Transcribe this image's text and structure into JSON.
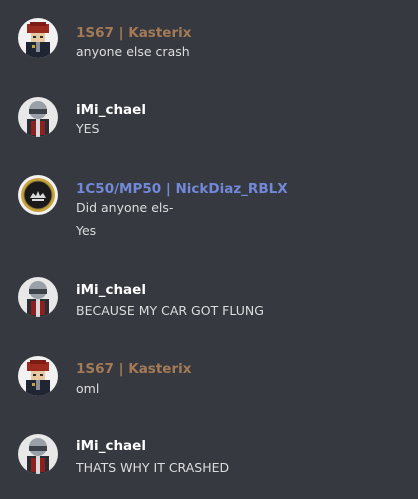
{
  "colors": {
    "background": "#36393f",
    "message_text": "#dcddde",
    "role_brown": "#a57b57",
    "role_white": "#ffffff",
    "role_blue": "#7289da"
  },
  "messages": [
    {
      "username": "1S67 | Kasterix",
      "username_color": "#a57b57",
      "avatar": "roblox-avatar-red-hat-icon",
      "lines": [
        "anyone else crash"
      ]
    },
    {
      "username": "iMi_chael",
      "username_color": "#ffffff",
      "avatar": "roblox-avatar-helmet-icon",
      "lines": [
        "YES"
      ]
    },
    {
      "username": "1C50/MP50 | NickDiaz_RBLX",
      "username_color": "#7289da",
      "avatar": "police-badge-emblem-icon",
      "lines": [
        "Did anyone els-",
        "Yes"
      ]
    },
    {
      "username": "iMi_chael",
      "username_color": "#ffffff",
      "avatar": "roblox-avatar-helmet-icon",
      "lines": [
        "BECAUSE MY CAR GOT FLUNG"
      ]
    },
    {
      "username": "1S67 | Kasterix",
      "username_color": "#a57b57",
      "avatar": "roblox-avatar-red-hat-icon",
      "lines": [
        "oml"
      ]
    },
    {
      "username": "iMi_chael",
      "username_color": "#ffffff",
      "avatar": "roblox-avatar-helmet-icon",
      "lines": [
        "THATS WHY IT CRASHED"
      ]
    }
  ]
}
